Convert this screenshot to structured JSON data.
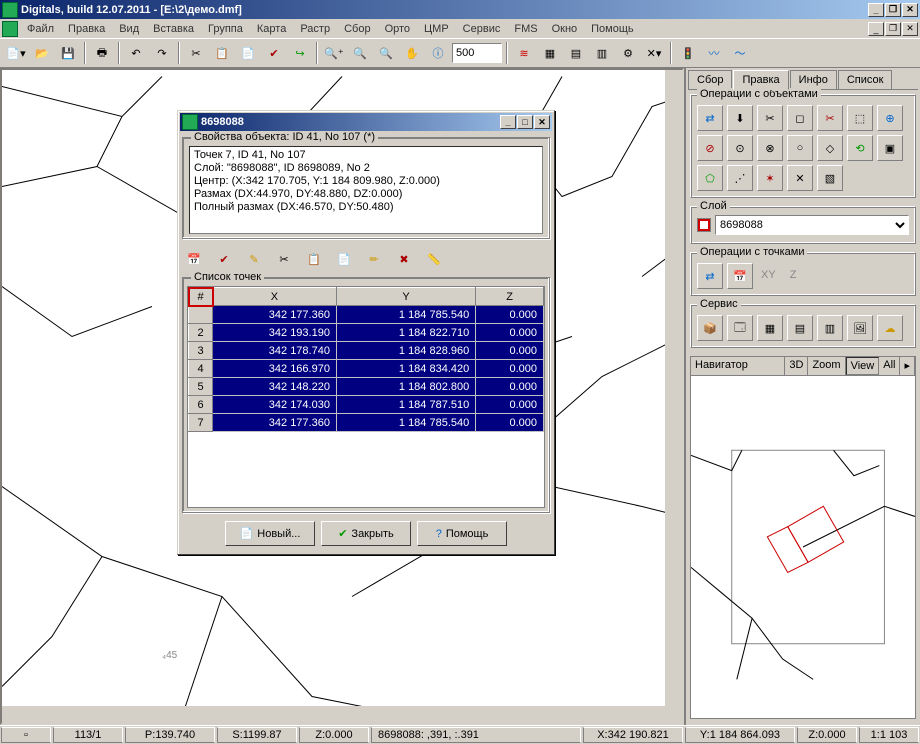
{
  "app": {
    "title": "Digitals, build 12.07.2011 - [E:\\2\\демо.dmf]"
  },
  "menu": [
    "Файл",
    "Правка",
    "Вид",
    "Вставка",
    "Группа",
    "Карта",
    "Растр",
    "Сбор",
    "Орто",
    "ЦМР",
    "Сервис",
    "FMS",
    "Окно",
    "Помощь"
  ],
  "toolbar": {
    "zoom_value": "500"
  },
  "tabs": {
    "items": [
      "Сбор",
      "Правка",
      "Инфо",
      "Список"
    ],
    "active": 1
  },
  "panel": {
    "ops_objects": "Операции с объектами",
    "layer_label": "Слой",
    "layer_value": "8698088",
    "ops_points": "Операции с точками",
    "service": "Сервис",
    "xy_label": "XY",
    "z_label": "Z",
    "navigator": "Навигатор",
    "nav_tabs": [
      "3D",
      "Zoom",
      "View",
      "All"
    ],
    "nav_active": 2
  },
  "dialog": {
    "title": "8698088",
    "props_legend": "Свойства объекта: ID 41, No 107 (*)",
    "props_lines": [
      "Точек 7, ID 41, No 107",
      "Слой: \"8698088\", ID 8698089, No 2",
      "Центр: (X:342 170.705, Y:1 184 809.980, Z:0.000)",
      "Размах (DX:44.970, DY:48.880, DZ:0.000)",
      "Полный размах (DX:46.570, DY:50.480)"
    ],
    "points_legend": "Список точек",
    "columns": [
      "#",
      "X",
      "Y",
      "Z"
    ],
    "rows": [
      {
        "n": "",
        "x": "342 177.360",
        "y": "1 184 785.540",
        "z": "0.000"
      },
      {
        "n": "2",
        "x": "342 193.190",
        "y": "1 184 822.710",
        "z": "0.000"
      },
      {
        "n": "3",
        "x": "342 178.740",
        "y": "1 184 828.960",
        "z": "0.000"
      },
      {
        "n": "4",
        "x": "342 166.970",
        "y": "1 184 834.420",
        "z": "0.000"
      },
      {
        "n": "5",
        "x": "342 148.220",
        "y": "1 184 802.800",
        "z": "0.000"
      },
      {
        "n": "6",
        "x": "342 174.030",
        "y": "1 184 787.510",
        "z": "0.000"
      },
      {
        "n": "7",
        "x": "342 177.360",
        "y": "1 184 785.540",
        "z": "0.000"
      }
    ],
    "btn_new": "Новый...",
    "btn_close": "Закрыть",
    "btn_help": "Помощь"
  },
  "map": {
    "label_45": "₄45"
  },
  "status": {
    "cells": [
      "113/1",
      "P:139.740",
      "S:1199.87",
      "Z:0.000",
      "8698088: ,391, :.391",
      "X:342 190.821",
      "Y:1 184 864.093",
      "Z:0.000",
      "1:1 103"
    ]
  }
}
